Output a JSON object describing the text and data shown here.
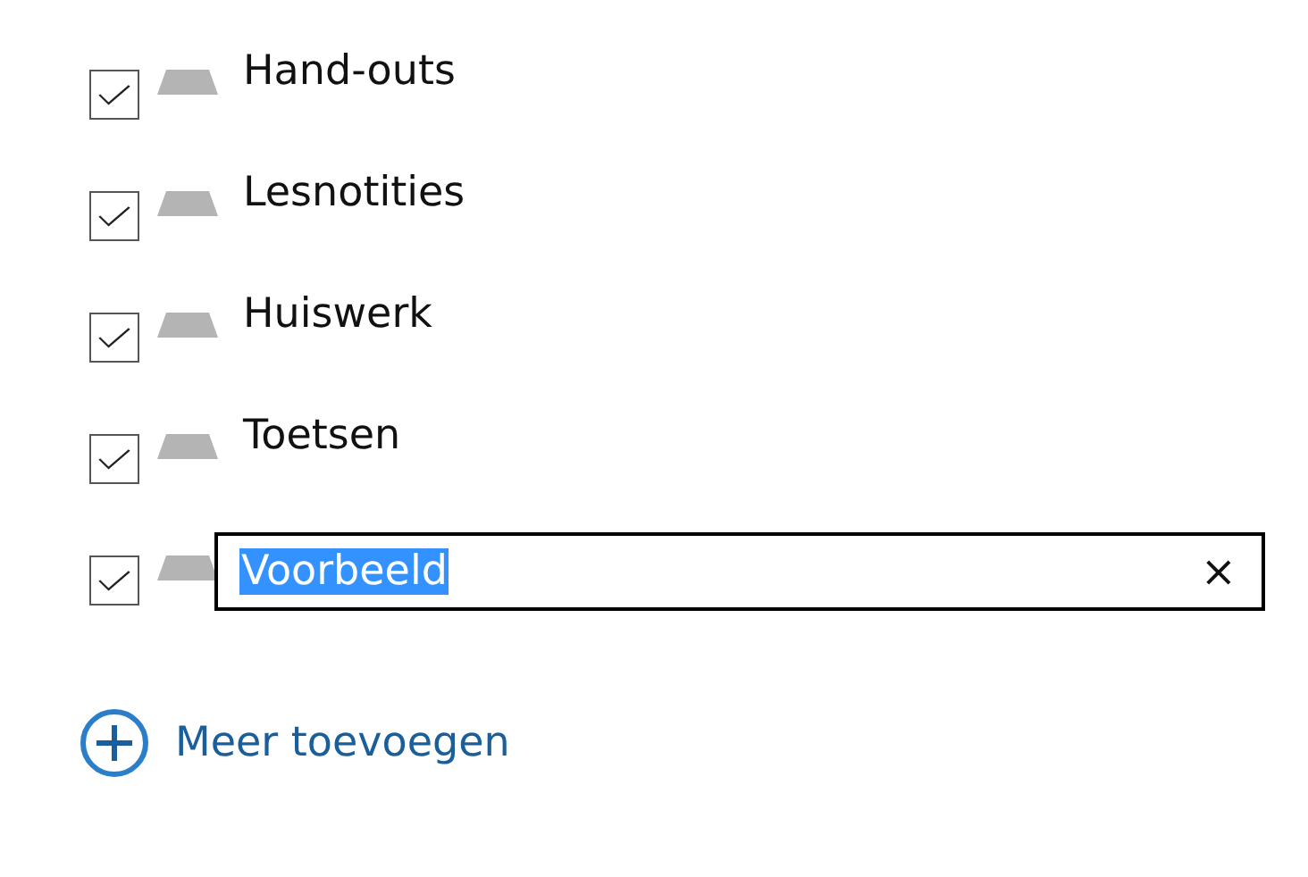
{
  "sections": [
    {
      "kind": "label",
      "label": "Hand-outs",
      "checked": true
    },
    {
      "kind": "label",
      "label": "Lesnotities",
      "checked": true
    },
    {
      "kind": "label",
      "label": "Huiswerk",
      "checked": true
    },
    {
      "kind": "label",
      "label": "Toetsen",
      "checked": true
    },
    {
      "kind": "editing",
      "value": "Voorbeeld",
      "text_selected": true,
      "clear_button": "×",
      "checked": true
    }
  ],
  "add_link": {
    "label": "Meer toevoegen"
  }
}
